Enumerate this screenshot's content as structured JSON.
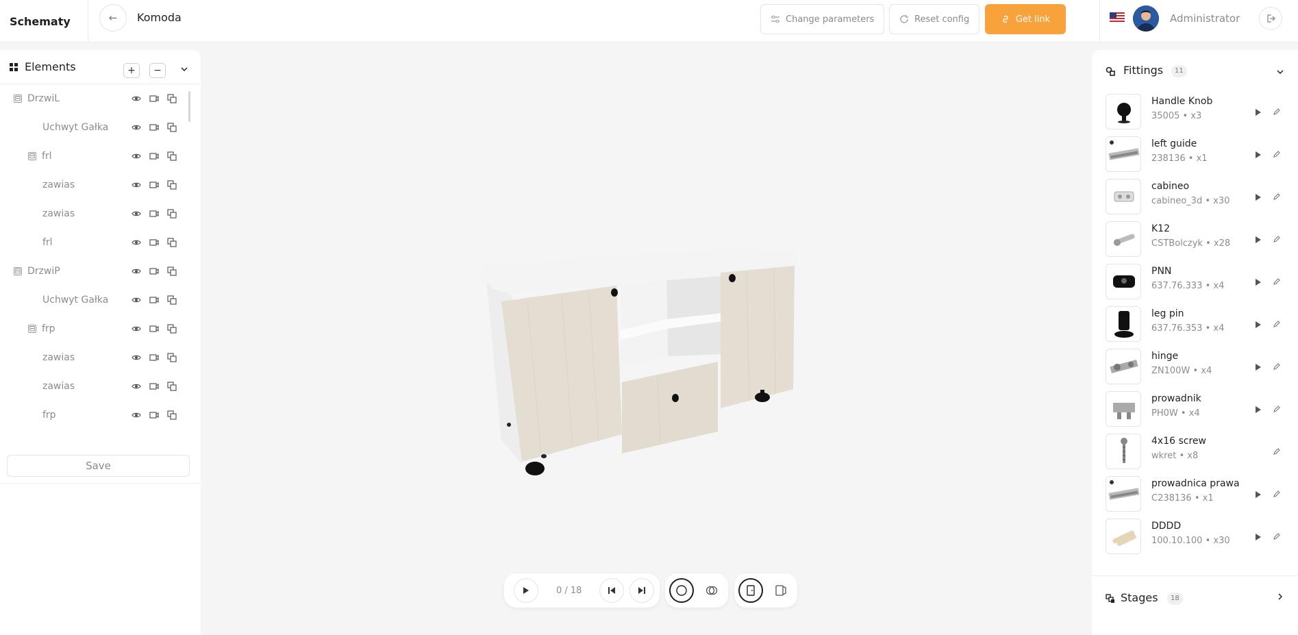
{
  "header": {
    "brand": "Schematy",
    "back_icon": "arrow-left-icon",
    "title": "Komoda",
    "change_parameters": "Change parameters",
    "reset_config": "Reset config",
    "get_link": "Get link",
    "user_name": "Administrator"
  },
  "colors": {
    "accent": "#f7a23b",
    "panel": "#ffffff",
    "background": "#f5f5f5"
  },
  "elements_panel": {
    "title": "Elements",
    "save": "Save",
    "rows": [
      {
        "label": "DrzwiL",
        "expander": "⊟"
      },
      {
        "label": "Uchwyt Gałka"
      },
      {
        "label": "frl",
        "expander": "⊟"
      },
      {
        "label": "zawias"
      },
      {
        "label": "zawias"
      },
      {
        "label": "frl"
      },
      {
        "label": "DrzwiP",
        "expander": "⊟"
      },
      {
        "label": "Uchwyt Gałka"
      },
      {
        "label": "frp",
        "expander": "⊟"
      },
      {
        "label": "zawias"
      },
      {
        "label": "zawias"
      },
      {
        "label": "frp"
      }
    ]
  },
  "fittings": {
    "title": "Fittings",
    "count": "11",
    "items": [
      {
        "name": "Handle Knob",
        "code": "35005",
        "qty": "x3"
      },
      {
        "name": "left guide",
        "code": "238136",
        "qty": "x1"
      },
      {
        "name": "cabineo",
        "code": "cabineo_3d",
        "qty": "x30"
      },
      {
        "name": "K12",
        "code": "CSTBolczyk",
        "qty": "x28"
      },
      {
        "name": "PNN",
        "code": "637.76.333",
        "qty": "x4"
      },
      {
        "name": "leg pin",
        "code": "637.76.353",
        "qty": "x4"
      },
      {
        "name": "hinge",
        "code": "ZN100W",
        "qty": "x4"
      },
      {
        "name": "prowadnik",
        "code": "PH0W",
        "qty": "x4"
      },
      {
        "name": "4x16 screw",
        "code": "wkret",
        "qty": "x8"
      },
      {
        "name": "prowadnica prawa",
        "code": "C238136",
        "qty": "x1"
      },
      {
        "name": "DDDD",
        "code": "100.10.100",
        "qty": "x30"
      }
    ]
  },
  "stages": {
    "title": "Stages",
    "count": "18"
  },
  "playback": {
    "counter": "0 / 18"
  }
}
